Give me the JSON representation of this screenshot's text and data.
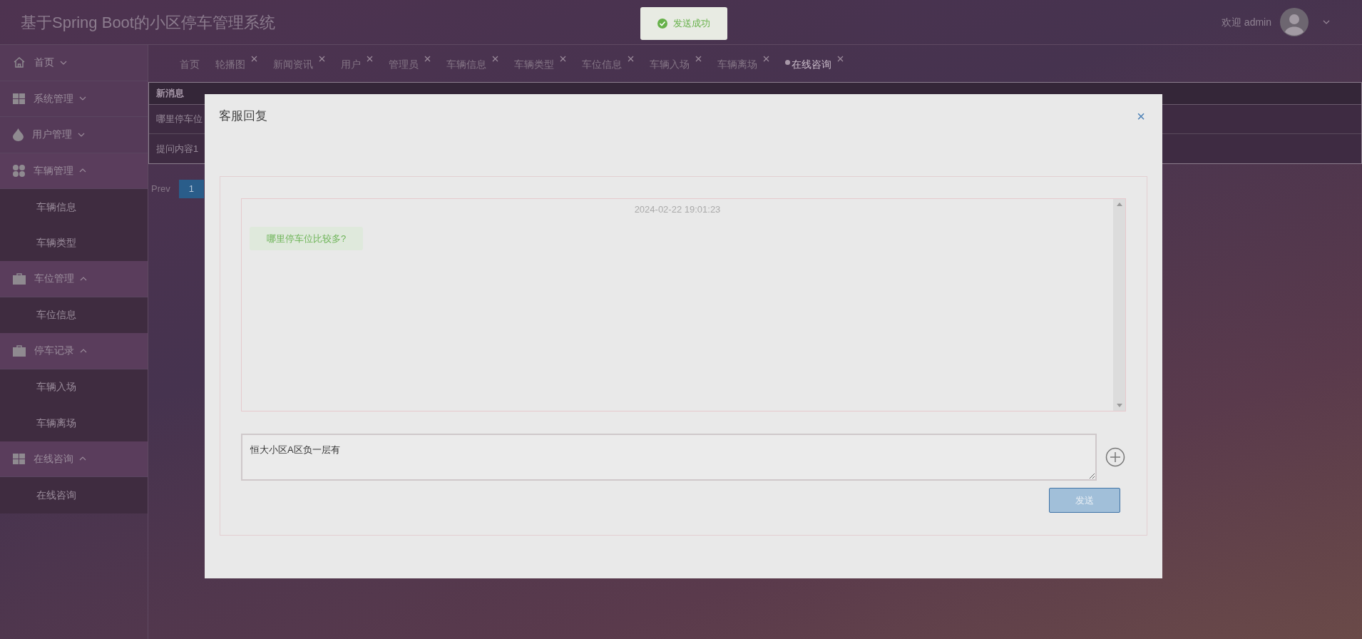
{
  "header": {
    "title": "基于Spring Boot的小区停车管理系统",
    "welcome": "欢迎 admin"
  },
  "toast": {
    "kind": "success",
    "text": "发送成功"
  },
  "sidebar": {
    "items": [
      {
        "label": "首页",
        "kind": "home",
        "expanded": false
      },
      {
        "label": "系统管理",
        "kind": "grid",
        "expanded": false
      },
      {
        "label": "用户管理",
        "kind": "drop",
        "expanded": false
      },
      {
        "label": "车辆管理",
        "kind": "dots",
        "expanded": true,
        "children": [
          {
            "label": "车辆信息"
          },
          {
            "label": "车辆类型"
          }
        ]
      },
      {
        "label": "车位管理",
        "kind": "case",
        "expanded": true,
        "children": [
          {
            "label": "车位信息"
          }
        ]
      },
      {
        "label": "停车记录",
        "kind": "case",
        "expanded": true,
        "children": [
          {
            "label": "车辆入场"
          },
          {
            "label": "车辆离场"
          }
        ]
      },
      {
        "label": "在线咨询",
        "kind": "grid",
        "expanded": true,
        "children": [
          {
            "label": "在线咨询"
          }
        ]
      }
    ]
  },
  "tabs": [
    {
      "label": "首页",
      "closable": false,
      "selected": false
    },
    {
      "label": "轮播图",
      "closable": true,
      "selected": false
    },
    {
      "label": "新闻资讯",
      "closable": true,
      "selected": false
    },
    {
      "label": "用户",
      "closable": true,
      "selected": false
    },
    {
      "label": "管理员",
      "closable": true,
      "selected": false
    },
    {
      "label": "车辆信息",
      "closable": true,
      "selected": false
    },
    {
      "label": "车辆类型",
      "closable": true,
      "selected": false
    },
    {
      "label": "车位信息",
      "closable": true,
      "selected": false
    },
    {
      "label": "车辆入场",
      "closable": true,
      "selected": false
    },
    {
      "label": "车辆离场",
      "closable": true,
      "selected": false
    },
    {
      "label": "在线咨询",
      "closable": true,
      "selected": true
    }
  ],
  "table": {
    "columns": [
      "新消息"
    ],
    "rows": [
      [
        "哪里停车位"
      ],
      [
        "提问内容1"
      ]
    ]
  },
  "pagination": {
    "prev": "Prev",
    "pages": [
      {
        "label": "1",
        "selected": true
      }
    ]
  },
  "dialog": {
    "title": "客服回复",
    "close": "×",
    "messages": [
      {
        "time": "2024-02-22 19:01:23",
        "text": "哪里停车位比较多?"
      }
    ],
    "reply": "恒大小区A区负一层有",
    "send": "发送"
  }
}
